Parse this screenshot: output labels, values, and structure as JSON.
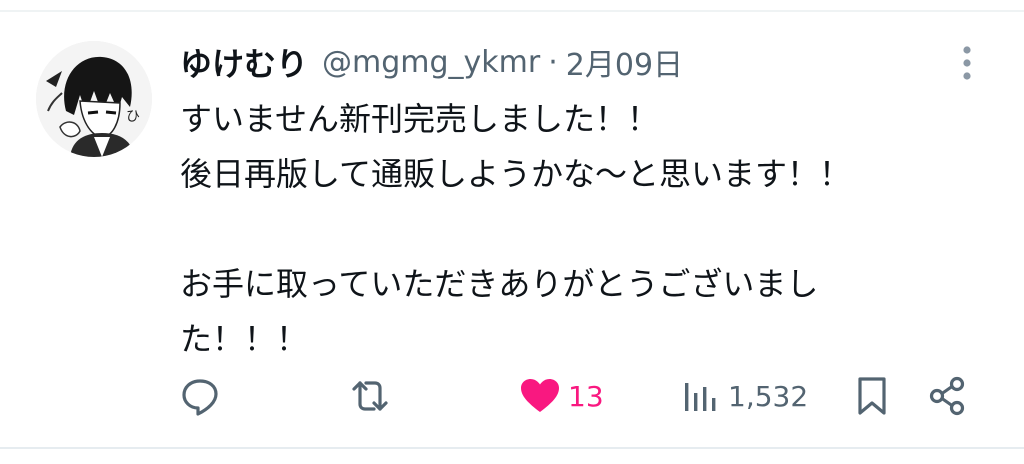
{
  "tweet": {
    "author": {
      "display_name": "ゆけむり",
      "handle": "@mgmg_ykmr"
    },
    "separator": "·",
    "timestamp": "2月09日",
    "text_lines": [
      "すいません新刊完売しました！！",
      "後日再版して通販しようかな〜と思います！！",
      "",
      "お手に取っていただきありがとうございまし",
      "た！！！"
    ],
    "actions": {
      "reply_icon": "reply-icon",
      "retweet_icon": "retweet-icon",
      "like_icon": "heart-filled-icon",
      "likes": "13",
      "views_icon": "analytics-icon",
      "views": "1,532",
      "bookmark_icon": "bookmark-icon",
      "share_icon": "share-icon"
    },
    "colors": {
      "like_pink": "#f91880",
      "icon_gray": "#536471",
      "text": "#0f1419"
    }
  }
}
